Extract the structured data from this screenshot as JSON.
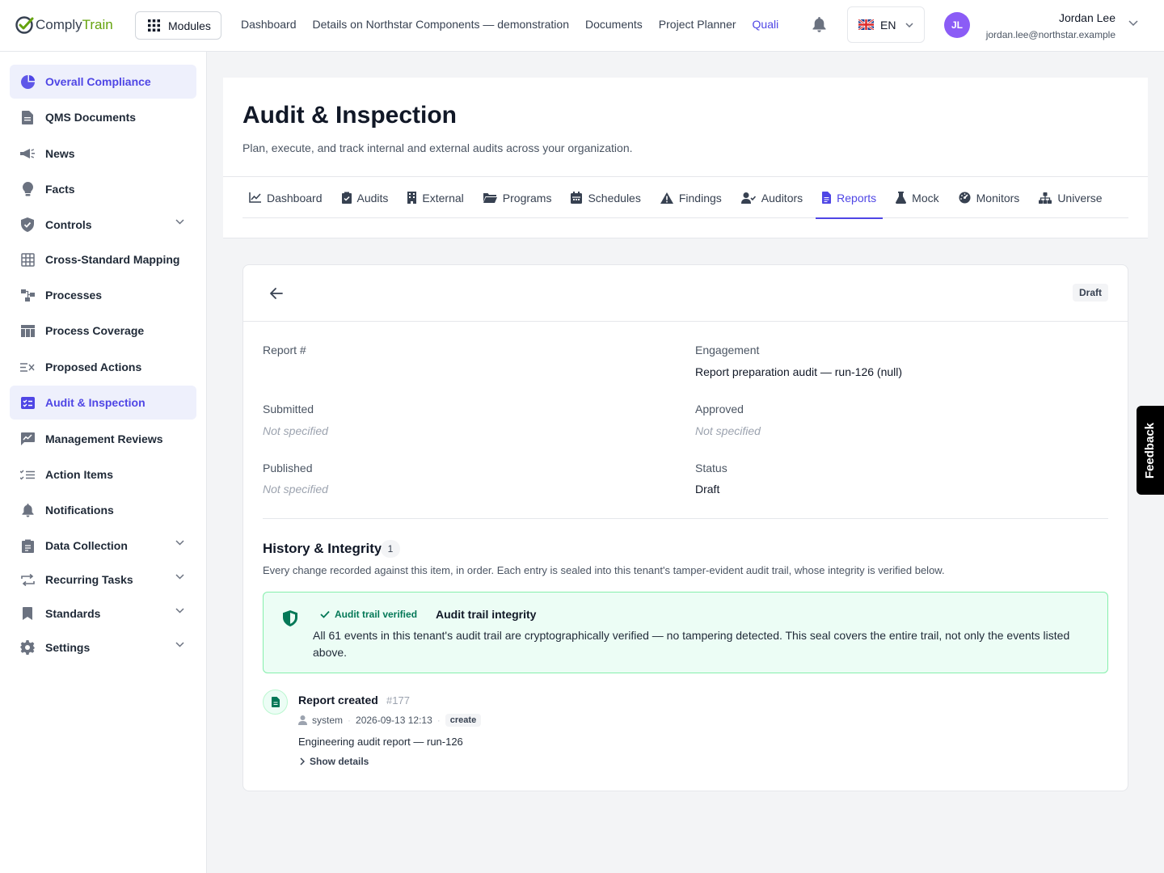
{
  "app": {
    "logo_part1": "Comply",
    "logo_part2": "Train",
    "modules_label": "Modules"
  },
  "topnav": {
    "items": [
      "Dashboard",
      "Details on Northstar Components — demonstration",
      "Documents",
      "Project Planner",
      "Quali"
    ],
    "active_index": 4
  },
  "lang": {
    "code": "EN",
    "flag": "uk-flag-icon"
  },
  "user": {
    "initials": "JL",
    "name": "Jordan Lee",
    "email": "jordan.lee@northstar.example"
  },
  "sidebar": {
    "items": [
      {
        "label": "Overall Compliance",
        "icon": "pie-chart-icon",
        "active": true
      },
      {
        "label": "QMS Documents",
        "icon": "document-icon"
      },
      {
        "label": "News",
        "icon": "megaphone-icon"
      },
      {
        "label": "Facts",
        "icon": "lightbulb-icon"
      },
      {
        "label": "Controls",
        "icon": "shield-check-icon",
        "expandable": true
      },
      {
        "label": "Cross-Standard Mapping",
        "icon": "grid-icon"
      },
      {
        "label": "Processes",
        "icon": "process-flow-icon"
      },
      {
        "label": "Process Coverage",
        "icon": "table-icon"
      },
      {
        "label": "Proposed Actions",
        "icon": "list-x-icon"
      },
      {
        "label": "Audit & Inspection",
        "icon": "checklist-icon",
        "active": true
      },
      {
        "label": "Management Reviews",
        "icon": "chart-edit-icon"
      },
      {
        "label": "Action Items",
        "icon": "list-check-icon"
      },
      {
        "label": "Notifications",
        "icon": "bell-icon"
      },
      {
        "label": "Data Collection",
        "icon": "clipboard-icon",
        "expandable": true
      },
      {
        "label": "Recurring Tasks",
        "icon": "repeat-icon",
        "expandable": true
      },
      {
        "label": "Standards",
        "icon": "bookmark-icon",
        "expandable": true
      },
      {
        "label": "Settings",
        "icon": "gear-icon",
        "expandable": true
      }
    ]
  },
  "page": {
    "title": "Audit & Inspection",
    "subtitle": "Plan, execute, and track internal and external audits across your organization."
  },
  "tabs": [
    {
      "label": "Dashboard",
      "icon": "line-chart-icon"
    },
    {
      "label": "Audits",
      "icon": "clipboard-check-icon"
    },
    {
      "label": "External",
      "icon": "building-icon"
    },
    {
      "label": "Programs",
      "icon": "folder-open-icon"
    },
    {
      "label": "Schedules",
      "icon": "calendar-icon"
    },
    {
      "label": "Findings",
      "icon": "warning-icon"
    },
    {
      "label": "Auditors",
      "icon": "user-check-icon"
    },
    {
      "label": "Reports",
      "icon": "file-text-icon",
      "active": true
    },
    {
      "label": "Mock",
      "icon": "flask-icon"
    },
    {
      "label": "Monitors",
      "icon": "gauge-icon"
    },
    {
      "label": "Universe",
      "icon": "hierarchy-icon"
    }
  ],
  "report": {
    "status_badge": "Draft",
    "fields": {
      "report_no_label": "Report #",
      "report_no_value": "",
      "engagement_label": "Engagement",
      "engagement_value": "Report preparation audit — run-126 (null)",
      "submitted_label": "Submitted",
      "submitted_value": "Not specified",
      "approved_label": "Approved",
      "approved_value": "Not specified",
      "published_label": "Published",
      "published_value": "Not specified",
      "status_label": "Status",
      "status_value": "Draft"
    }
  },
  "history": {
    "title": "History & Integrity",
    "count": "1",
    "description": "Every change recorded against this item, in order. Each entry is sealed into this tenant's tamper-evident audit trail, whose integrity is verified below.",
    "integrity": {
      "verified_label": "Audit trail verified",
      "title": "Audit trail integrity",
      "text": "All 61 events in this tenant's audit trail are cryptographically verified — no tampering detected. This seal covers the entire trail, not only the events listed above."
    },
    "event": {
      "title": "Report created",
      "id": "#177",
      "actor": "system",
      "timestamp": "2026-09-13 12:13",
      "tag": "create",
      "description": "Engineering audit report — run-126",
      "show_details": "Show details"
    }
  },
  "feedback_label": "Feedback",
  "colors": {
    "accent": "#4f46e5",
    "success": "#047857",
    "success_bg": "#ecfdf5",
    "logo_green": "#65a30d"
  }
}
